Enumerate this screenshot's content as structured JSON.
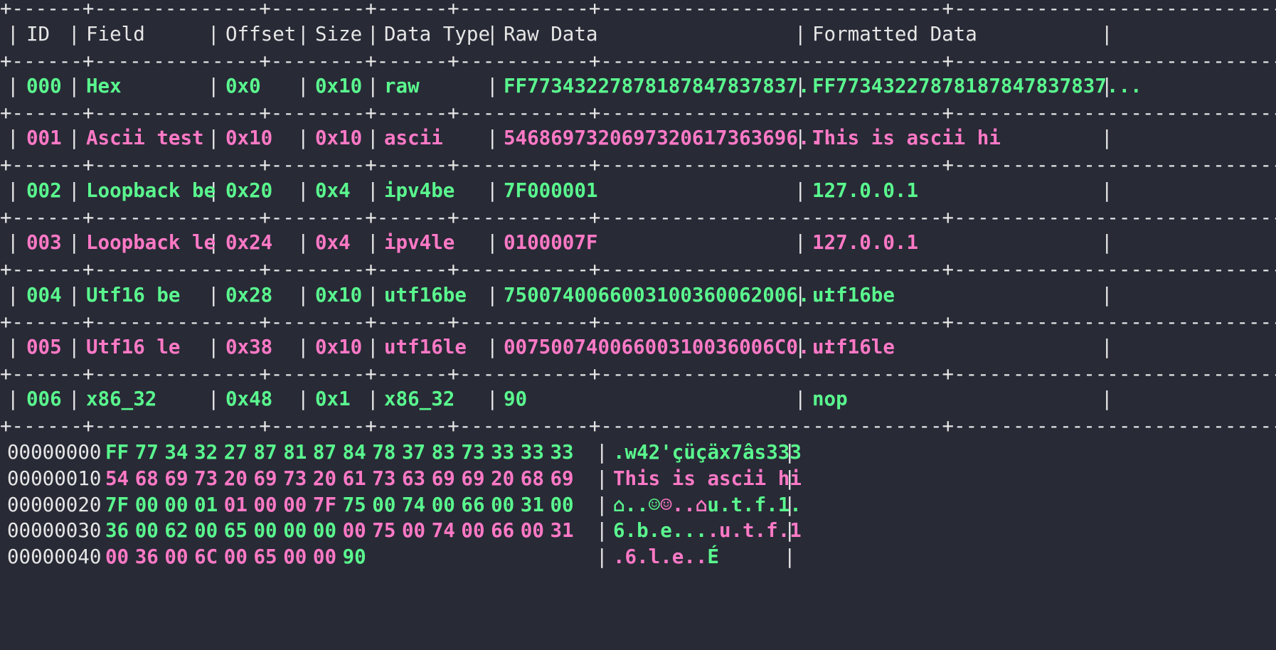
{
  "table": {
    "headers": [
      "ID",
      "Field",
      "Offset",
      "Size",
      "Data Type",
      "Raw Data",
      "Formatted Data"
    ],
    "rows": [
      {
        "id": "000",
        "field": "Hex",
        "offset": "0x0",
        "size": "0x10",
        "type": "raw",
        "raw": "FF773432278781878478378 37...",
        "formatted": "FF77343227878187847837837...",
        "color": "green"
      },
      {
        "id": "001",
        "field": "Ascii test",
        "offset": "0x10",
        "size": "0x10",
        "type": "ascii",
        "raw": "5468697320697320617363696...",
        "formatted": "This is ascii hi",
        "color": "pink"
      },
      {
        "id": "002",
        "field": "Loopback be",
        "offset": "0x20",
        "size": "0x4",
        "type": "ipv4be",
        "raw": "7F000001",
        "formatted": "127.0.0.1",
        "color": "green"
      },
      {
        "id": "003",
        "field": "Loopback le",
        "offset": "0x24",
        "size": "0x4",
        "type": "ipv4le",
        "raw": "0100007F",
        "formatted": "127.0.0.1",
        "color": "pink"
      },
      {
        "id": "004",
        "field": "Utf16 be",
        "offset": "0x28",
        "size": "0x10",
        "type": "utf16be",
        "raw": "7500740066003100360062006...",
        "formatted": "utf16be",
        "color": "green"
      },
      {
        "id": "005",
        "field": "Utf16 le",
        "offset": "0x38",
        "size": "0x10",
        "type": "utf16le",
        "raw": "0075007400660031003600 6C0...",
        "formatted": "utf16le",
        "color": "pink"
      },
      {
        "id": "006",
        "field": "x86_32",
        "offset": "0x48",
        "size": "0x1",
        "type": "x86_32",
        "raw": "90",
        "formatted": "nop",
        "color": "green"
      }
    ]
  },
  "hexdump": [
    {
      "offset": "00000000",
      "bytes": [
        [
          "FF",
          "g"
        ],
        [
          "77",
          "g"
        ],
        [
          "34",
          "g"
        ],
        [
          "32",
          "g"
        ],
        [
          "27",
          "g"
        ],
        [
          "87",
          "g"
        ],
        [
          "81",
          "g"
        ],
        [
          "87",
          "g"
        ],
        [
          "84",
          "g"
        ],
        [
          "78",
          "g"
        ],
        [
          "37",
          "g"
        ],
        [
          "83",
          "g"
        ],
        [
          "73",
          "g"
        ],
        [
          "33",
          "g"
        ],
        [
          "33",
          "g"
        ],
        [
          "33",
          "g"
        ]
      ],
      "ascii": [
        [
          ".w42'çüçäx7âs333",
          "g"
        ]
      ]
    },
    {
      "offset": "00000010",
      "bytes": [
        [
          "54",
          "p"
        ],
        [
          "68",
          "p"
        ],
        [
          "69",
          "p"
        ],
        [
          "73",
          "p"
        ],
        [
          "20",
          "p"
        ],
        [
          "69",
          "p"
        ],
        [
          "73",
          "p"
        ],
        [
          "20",
          "p"
        ],
        [
          "61",
          "p"
        ],
        [
          "73",
          "p"
        ],
        [
          "63",
          "p"
        ],
        [
          "69",
          "p"
        ],
        [
          "69",
          "p"
        ],
        [
          "20",
          "p"
        ],
        [
          "68",
          "p"
        ],
        [
          "69",
          "p"
        ]
      ],
      "ascii": [
        [
          "This is ascii hi",
          "p"
        ]
      ]
    },
    {
      "offset": "00000020",
      "bytes": [
        [
          "7F",
          "g"
        ],
        [
          "00",
          "g"
        ],
        [
          "00",
          "g"
        ],
        [
          "01",
          "g"
        ],
        [
          "01",
          "p"
        ],
        [
          "00",
          "p"
        ],
        [
          "00",
          "p"
        ],
        [
          "7F",
          "p"
        ],
        [
          "75",
          "g"
        ],
        [
          "00",
          "g"
        ],
        [
          "74",
          "g"
        ],
        [
          "00",
          "g"
        ],
        [
          "66",
          "g"
        ],
        [
          "00",
          "g"
        ],
        [
          "31",
          "g"
        ],
        [
          "00",
          "g"
        ]
      ],
      "ascii": [
        [
          "⌂..☺",
          "g"
        ],
        [
          "☺..⌂",
          "p"
        ],
        [
          "u.t.f.1.",
          "g"
        ]
      ]
    },
    {
      "offset": "00000030",
      "bytes": [
        [
          "36",
          "g"
        ],
        [
          "00",
          "g"
        ],
        [
          "62",
          "g"
        ],
        [
          "00",
          "g"
        ],
        [
          "65",
          "g"
        ],
        [
          "00",
          "g"
        ],
        [
          "00",
          "g"
        ],
        [
          "00",
          "g"
        ],
        [
          "00",
          "p"
        ],
        [
          "75",
          "p"
        ],
        [
          "00",
          "p"
        ],
        [
          "74",
          "p"
        ],
        [
          "00",
          "p"
        ],
        [
          "66",
          "p"
        ],
        [
          "00",
          "p"
        ],
        [
          "31",
          "p"
        ]
      ],
      "ascii": [
        [
          "6.b.e...",
          "g"
        ],
        [
          ".u.t.f.1",
          "p"
        ]
      ]
    },
    {
      "offset": "00000040",
      "bytes": [
        [
          "00",
          "p"
        ],
        [
          "36",
          "p"
        ],
        [
          "00",
          "p"
        ],
        [
          "6C",
          "p"
        ],
        [
          "00",
          "p"
        ],
        [
          "65",
          "p"
        ],
        [
          "00",
          "p"
        ],
        [
          "00",
          "p"
        ],
        [
          "90",
          "g"
        ]
      ],
      "ascii": [
        [
          ".6.l.e..",
          "p"
        ],
        [
          "É",
          "g"
        ]
      ]
    }
  ],
  "colors": {
    "background": "#282a36",
    "green": "#5af78e",
    "pink": "#ff79c6",
    "text": "#e6e6e6"
  }
}
